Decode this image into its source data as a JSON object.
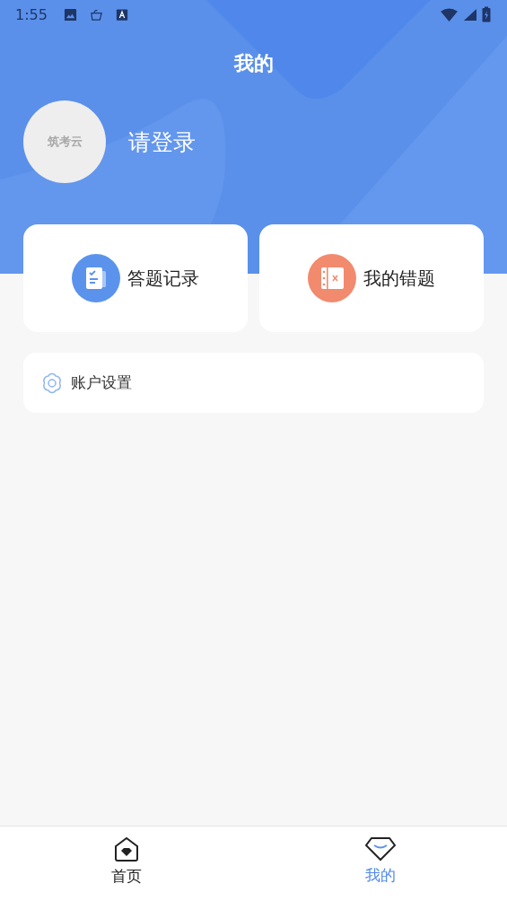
{
  "status_bar": {
    "time": "1:55"
  },
  "header": {
    "title": "我的"
  },
  "profile": {
    "avatar_text": "筑考云",
    "login_prompt": "请登录"
  },
  "shortcuts": [
    {
      "kind": "record",
      "label": "答题记录"
    },
    {
      "kind": "mistakes",
      "label": "我的错题"
    }
  ],
  "menu": [
    {
      "kind": "settings",
      "label": "账户设置"
    }
  ],
  "bottom_nav": [
    {
      "kind": "home",
      "label": "首页",
      "selected": false
    },
    {
      "kind": "mine",
      "label": "我的",
      "selected": true
    }
  ]
}
